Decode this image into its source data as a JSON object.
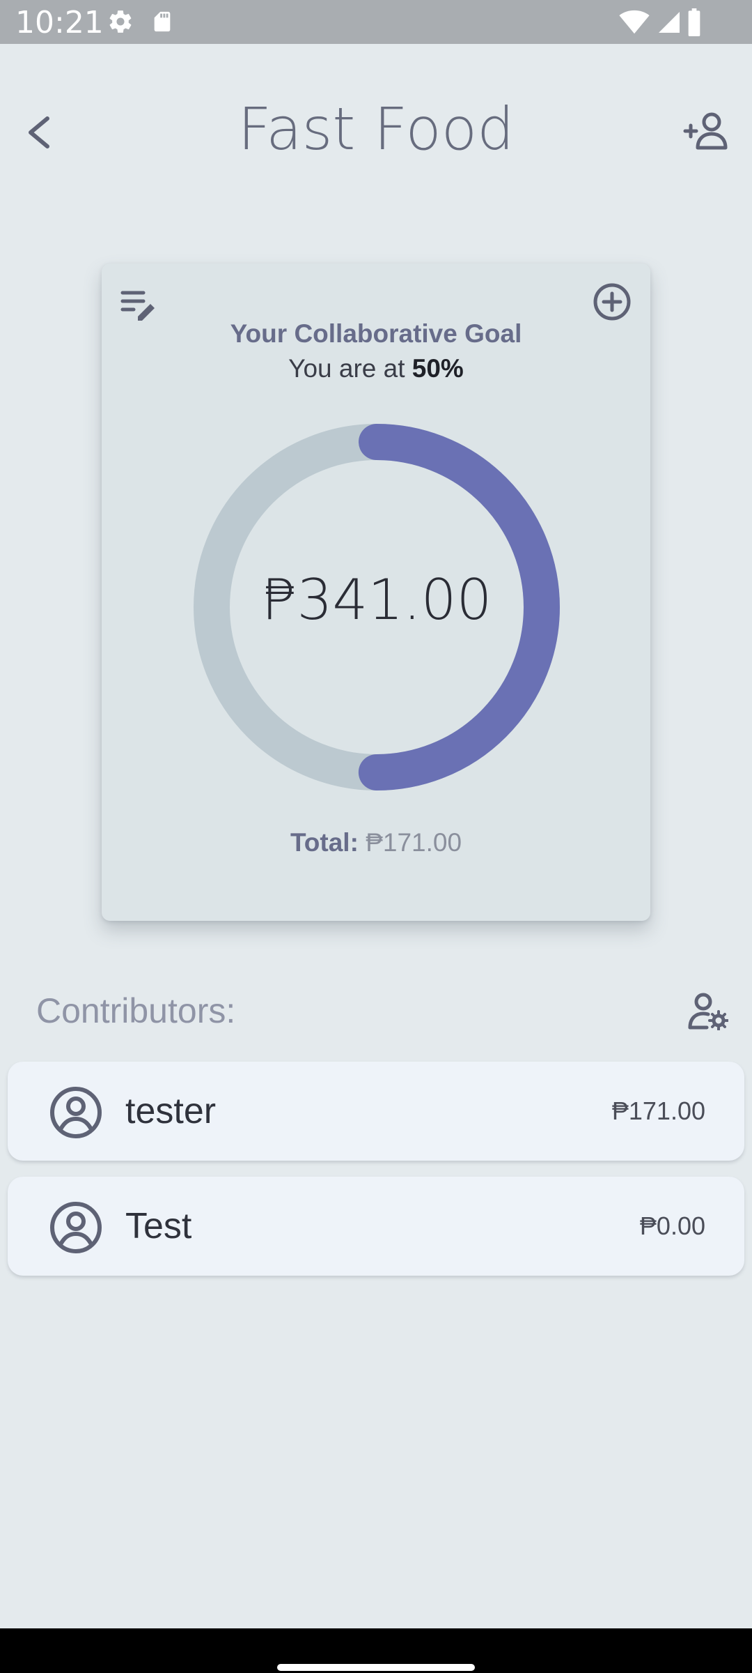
{
  "status_bar": {
    "time": "10:21",
    "icons": [
      "settings-icon",
      "sd-card-icon",
      "wifi-icon",
      "signal-icon",
      "battery-icon"
    ]
  },
  "header": {
    "title": "Fast Food",
    "back_icon": "chevron-left-icon",
    "add_person_icon": "person-add-icon"
  },
  "goal_card": {
    "edit_icon": "edit-notes-icon",
    "add_icon": "add-circle-icon",
    "title": "Your Collaborative Goal",
    "progress_prefix": "You are at ",
    "progress_value": "50%",
    "progress_fraction": 0.5,
    "goal_amount": "₱341.00",
    "total_label": "Total:",
    "total_value": "₱171.00"
  },
  "contributors": {
    "label": "Contributors:",
    "manage_icon": "person-settings-icon",
    "items": [
      {
        "name": "tester",
        "amount": "₱171.00",
        "avatar_icon": "account-circle-icon"
      },
      {
        "name": "Test",
        "amount": "₱0.00",
        "avatar_icon": "account-circle-icon"
      }
    ]
  },
  "colors": {
    "background": "#e4eaed",
    "card": "#dce4e7",
    "ring_track": "#bcc9d0",
    "ring_progress": "#6a71b4",
    "row_background": "#eef3f9",
    "icon": "#5e6275",
    "status_bar": "#a9adb1"
  }
}
